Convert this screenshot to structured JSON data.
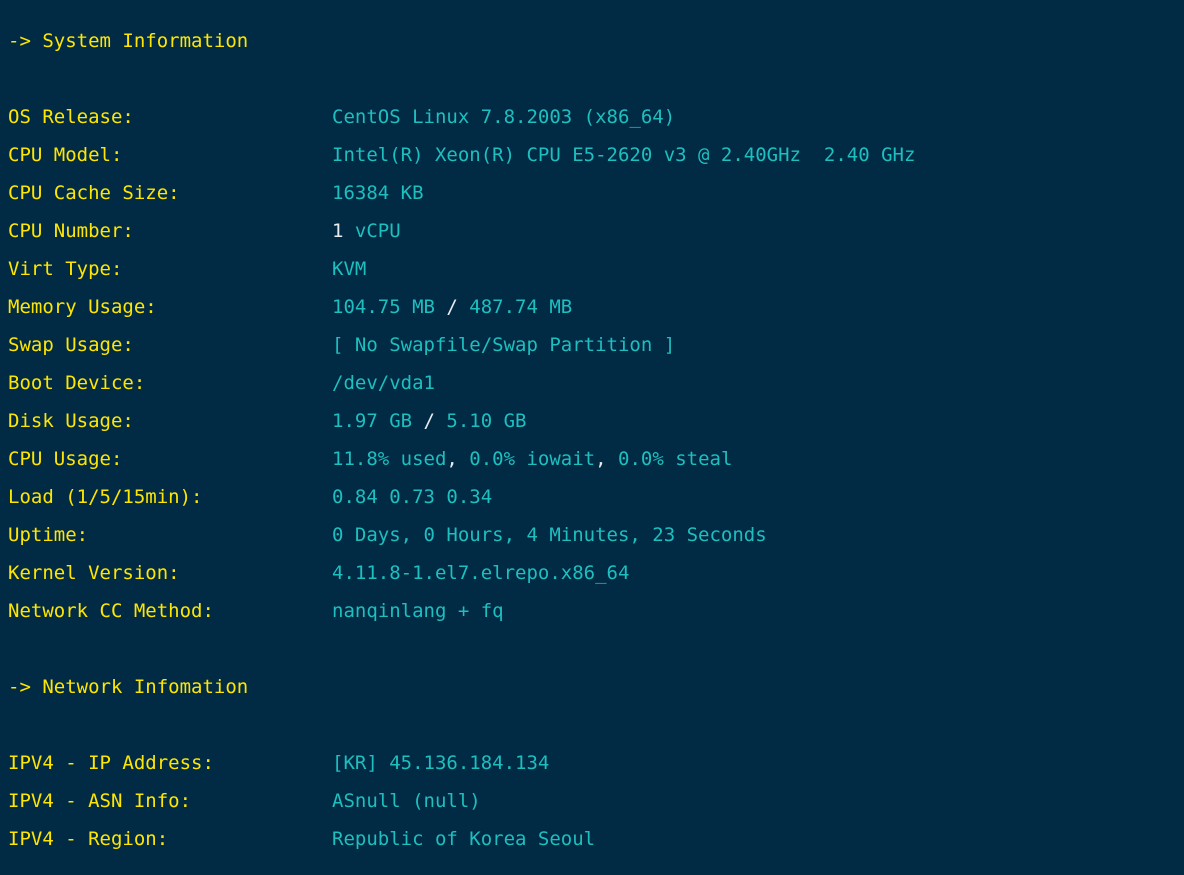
{
  "terminal": {
    "background_color": "#012b45",
    "label_color": "#ffe600",
    "value_color": "#1dbfbf",
    "punctuation_color": "#e9ecef"
  },
  "system_section": {
    "heading": "-> System Information",
    "rows": [
      {
        "label": "OS Release:",
        "value": "CentOS Linux 7.8.2003 (x86_64)"
      },
      {
        "label": "CPU Model:",
        "value": "Intel(R) Xeon(R) CPU E5-2620 v3 @ 2.40GHz  2.40 GHz"
      },
      {
        "label": "CPU Cache Size:",
        "value": "16384 KB"
      },
      {
        "label": "CPU Number:",
        "value_num": "1",
        "value_unit": " vCPU"
      },
      {
        "label": "Virt Type:",
        "value": "KVM"
      },
      {
        "label": "Memory Usage:",
        "value_a": "104.75 MB ",
        "sep": "/",
        "value_b": " 487.74 MB"
      },
      {
        "label": "Swap Usage:",
        "value": "[ No Swapfile/Swap Partition ]"
      },
      {
        "label": "Boot Device:",
        "value": "/dev/vda1"
      },
      {
        "label": "Disk Usage:",
        "value_a": "1.97 GB ",
        "sep": "/",
        "value_b": " 5.10 GB"
      },
      {
        "label": "CPU Usage:",
        "cpu_used": "11.8% used",
        "cpu_c1": ",",
        "cpu_iowait": " 0.0% iowait",
        "cpu_c2": ",",
        "cpu_steal": " 0.0% steal"
      },
      {
        "label": "Load (1/5/15min):",
        "value": "0.84 0.73 0.34"
      },
      {
        "label": "Uptime:",
        "value": "0 Days, 0 Hours, 4 Minutes, 23 Seconds"
      },
      {
        "label": "Kernel Version:",
        "value": "4.11.8-1.el7.elrepo.x86_64"
      },
      {
        "label": "Network CC Method:",
        "value": "nanqinlang + fq"
      }
    ]
  },
  "network_section": {
    "heading": "-> Network Infomation",
    "rows": [
      {
        "label": "IPV4 - IP Address:",
        "value": "[KR] 45.136.184.134"
      },
      {
        "label": "IPV4 - ASN Info:",
        "value": "ASnull (null)"
      },
      {
        "label": "IPV4 - Region:",
        "value": "Republic of Korea Seoul"
      }
    ]
  }
}
